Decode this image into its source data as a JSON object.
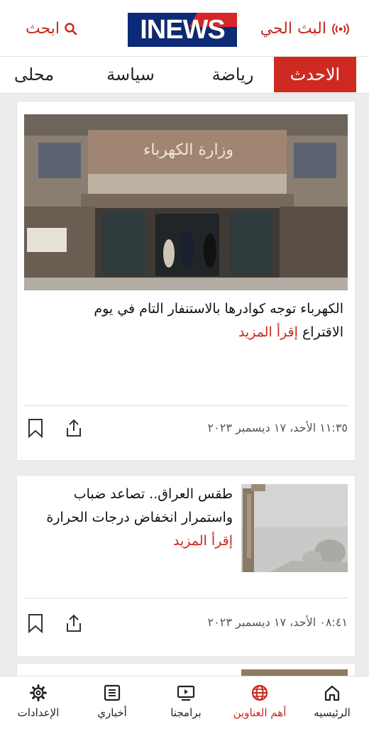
{
  "header": {
    "live_label": "البث الحي",
    "search_label": "ابحث",
    "logo_text": "INEWS",
    "accent_color": "#c8281e"
  },
  "tabs": [
    {
      "label": "الاحدث",
      "active": true
    },
    {
      "label": "رياضة",
      "active": false
    },
    {
      "label": "سياسة",
      "active": false
    },
    {
      "label": "محلى",
      "active": false
    }
  ],
  "articles": [
    {
      "title": "الكهرباء توجه كوادرها بالاستنفار التام في يوم الاقتراع",
      "read_more": "إقرأ المزيد",
      "timestamp": "١١:٣٥ الأحد، ١٧ ديسمبر ٢٠٢٣",
      "image": "ministry-of-electricity-building",
      "image_sign": "وزارة الكهرباء"
    },
    {
      "title": "طقس العراق.. تصاعد ضباب واستمرار انخفاض درجات الحرارة",
      "read_more": "إقرأ المزيد",
      "timestamp": "٠٨:٤١ الأحد، ١٧ ديسمبر ٢٠٢٣",
      "image": "foggy-street"
    }
  ],
  "bottom_nav": [
    {
      "label": "الرئيسيه",
      "icon": "home-icon",
      "active": false
    },
    {
      "label": "أهم العناوين",
      "icon": "globe-icon",
      "active": true
    },
    {
      "label": "برامجنا",
      "icon": "tv-icon",
      "active": false
    },
    {
      "label": "أخباري",
      "icon": "news-list-icon",
      "active": false
    },
    {
      "label": "الإعدادات",
      "icon": "gear-icon",
      "active": false
    }
  ]
}
